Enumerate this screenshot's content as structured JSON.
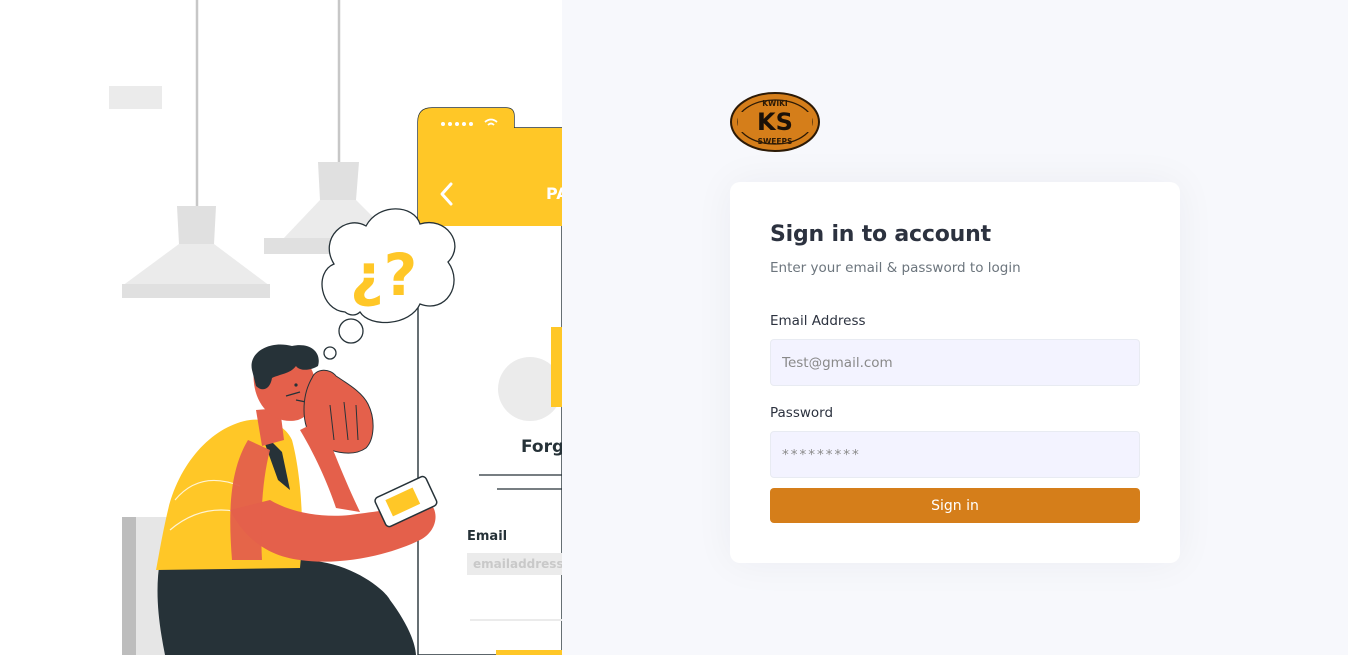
{
  "logo": {
    "brand_initials": "KS",
    "top_text": "KWIKI",
    "bottom_text": "SWEEPS",
    "color": "#d57e1a"
  },
  "illustration": {
    "phone_header": "PA",
    "heading": "Forg",
    "email_label": "Email",
    "email_placeholder": "emailaddress@",
    "thought_symbols": "¿?",
    "accent_color": "#ffc727",
    "skin_color": "#e4604b",
    "dark_color": "#263238"
  },
  "login": {
    "title": "Sign in to account",
    "subtitle": "Enter your email & password to login",
    "email_label": "Email Address",
    "email_placeholder": "Test@gmail.com",
    "password_label": "Password",
    "password_placeholder": "*********",
    "submit_label": "Sign in"
  },
  "colors": {
    "accent": "#d57e1a",
    "input_bg": "#f3f3ff",
    "page_bg": "#f7f8fc"
  }
}
